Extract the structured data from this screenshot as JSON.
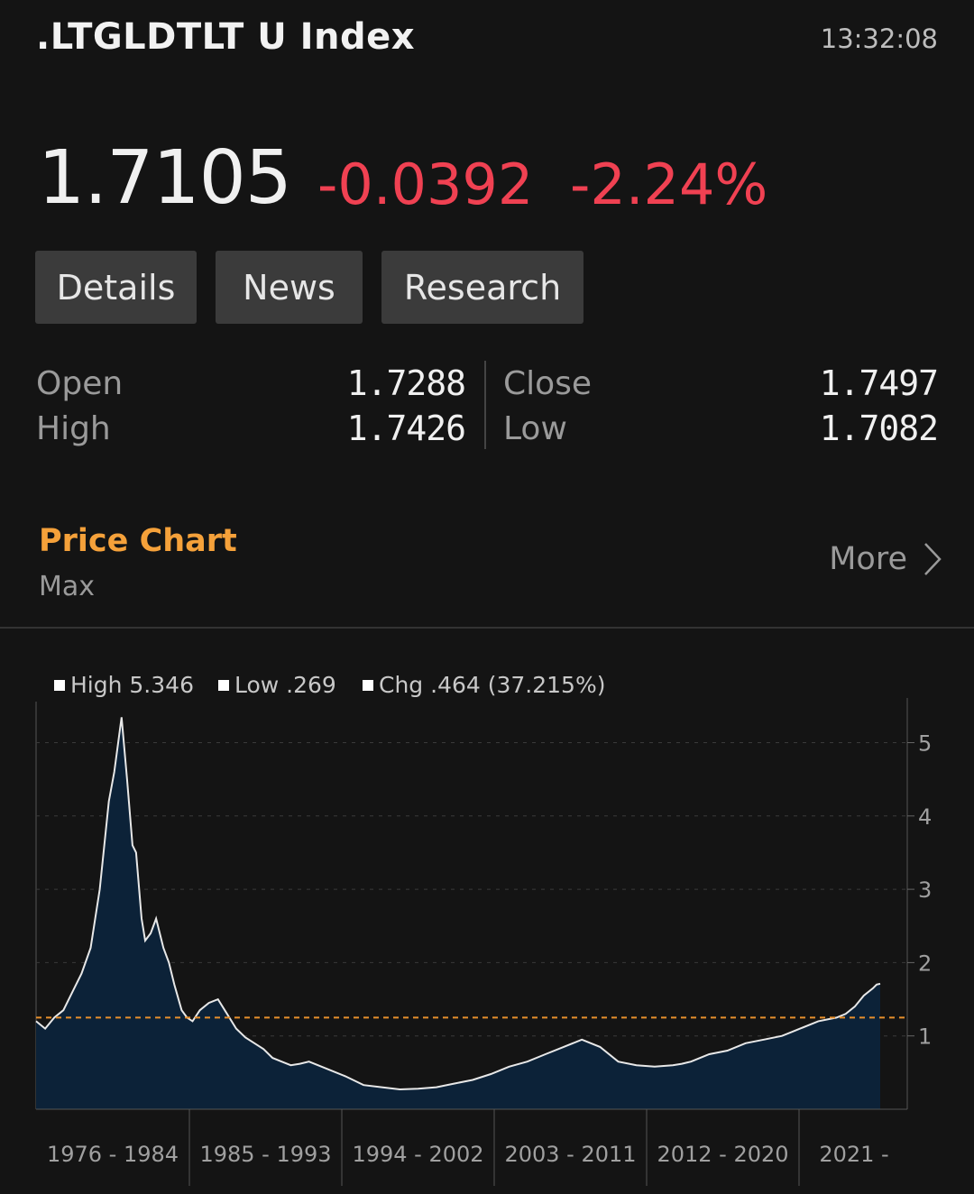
{
  "header": {
    "title": ".LTGLDTLT U Index",
    "time": "13:32:08"
  },
  "quote": {
    "price": "1.7105",
    "change": "-0.0392",
    "change_pct": "-2.24%"
  },
  "colors": {
    "negative": "#f04152",
    "accent": "#f5a13a",
    "chart_fill": "#0c2238",
    "reference_line": "#e8902c"
  },
  "tabs": [
    {
      "label": "Details"
    },
    {
      "label": "News"
    },
    {
      "label": "Research"
    }
  ],
  "stats": {
    "open": {
      "label": "Open",
      "value": "1.7288"
    },
    "high": {
      "label": "High",
      "value": "1.7426"
    },
    "close": {
      "label": "Close",
      "value": "1.7497"
    },
    "low": {
      "label": "Low",
      "value": "1.7082"
    }
  },
  "price_chart": {
    "title": "Price Chart",
    "range": "Max",
    "more_label": "More"
  },
  "chart_data": {
    "type": "area",
    "legend": [
      {
        "label": "High 5.346"
      },
      {
        "label": "Low .269"
      },
      {
        "label": "Chg .464 (37.215%)"
      }
    ],
    "y_ticks": [
      "1",
      "2",
      "3",
      "4",
      "5"
    ],
    "ylim": [
      0,
      5.5
    ],
    "x_ticks": [
      "1976 - 1984",
      "1985 - 1993",
      "1994 - 2002",
      "2003 - 2011",
      "2012 - 2020",
      "2021 -"
    ],
    "xlim": [
      1976,
      2022.4
    ],
    "reference_value": 1.25,
    "grid": true,
    "series": [
      {
        "x": [
          1976.0,
          1976.5,
          1977.0,
          1977.5,
          1978.0,
          1978.5,
          1979.0,
          1979.5,
          1980.0,
          1980.3,
          1980.7,
          1981.0,
          1981.3,
          1981.5,
          1981.8,
          1982.0,
          1982.3,
          1982.6,
          1983.0,
          1983.3,
          1983.6,
          1984.0,
          1984.3,
          1984.6,
          1985.0,
          1985.5,
          1986.0,
          1986.5,
          1987.0,
          1987.5,
          1988.0,
          1988.5,
          1989.0,
          1989.5,
          1990.0,
          1990.5,
          1991.0,
          1992.0,
          1993.0,
          1994.0,
          1995.0,
          1996.0,
          1997.0,
          1998.0,
          1999.0,
          2000.0,
          2001.0,
          2002.0,
          2003.0,
          2004.0,
          2005.0,
          2006.0,
          2007.0,
          2008.0,
          2009.0,
          2010.0,
          2011.0,
          2011.5,
          2012.0,
          2012.5,
          2013.0,
          2014.0,
          2015.0,
          2016.0,
          2017.0,
          2018.0,
          2019.0,
          2020.0,
          2020.5,
          2021.0,
          2021.5,
          2022.0,
          2022.2,
          2022.4
        ],
        "y": [
          1.2,
          1.1,
          1.25,
          1.35,
          1.6,
          1.85,
          2.2,
          3.0,
          4.2,
          4.6,
          5.346,
          4.5,
          3.6,
          3.5,
          2.6,
          2.3,
          2.4,
          2.6,
          2.2,
          2.0,
          1.7,
          1.35,
          1.25,
          1.2,
          1.35,
          1.45,
          1.5,
          1.3,
          1.1,
          0.98,
          0.9,
          0.82,
          0.7,
          0.65,
          0.6,
          0.62,
          0.65,
          0.55,
          0.45,
          0.33,
          0.3,
          0.27,
          0.28,
          0.3,
          0.35,
          0.4,
          0.48,
          0.58,
          0.65,
          0.75,
          0.85,
          0.95,
          0.85,
          0.65,
          0.6,
          0.58,
          0.6,
          0.62,
          0.65,
          0.7,
          0.75,
          0.8,
          0.9,
          0.95,
          1.0,
          1.1,
          1.2,
          1.25,
          1.3,
          1.4,
          1.55,
          1.65,
          1.7,
          1.7105
        ]
      }
    ]
  }
}
